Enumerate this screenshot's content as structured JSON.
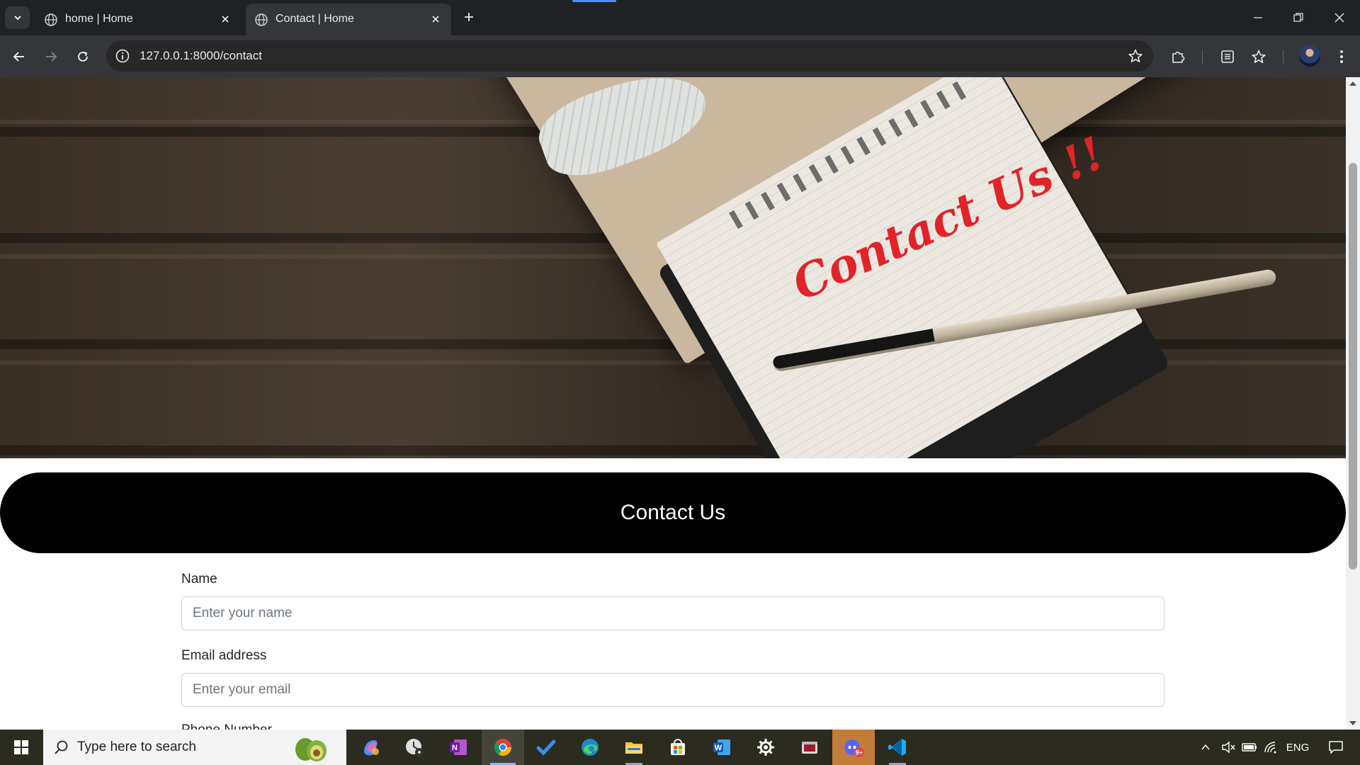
{
  "browser": {
    "tabs": [
      {
        "title": "home | Home",
        "active": false
      },
      {
        "title": "Contact | Home",
        "active": true
      }
    ],
    "address": "127.0.0.1:8000/contact"
  },
  "page": {
    "hero_text": "Contact Us !!",
    "banner_title": "Contact Us",
    "form": {
      "name_label": "Name",
      "name_placeholder": "Enter your name",
      "email_label": "Email address",
      "email_placeholder": "Enter your email",
      "phone_label": "Phone Number"
    }
  },
  "taskbar": {
    "search_placeholder": "Type here to search",
    "apps": [
      "copilot-icon",
      "clock-icon",
      "onenote-icon",
      "chrome-icon",
      "todo-icon",
      "edge-icon",
      "file-explorer-icon",
      "store-icon",
      "word-icon",
      "settings-icon",
      "snipping-icon",
      "discord-icon",
      "vscode-icon"
    ],
    "language": "ENG",
    "discord_badge": "9+"
  },
  "colors": {
    "browser_dark": "#202124",
    "toolbar": "#35363a",
    "banner": "#000000",
    "hero_text": "#e0242a"
  }
}
